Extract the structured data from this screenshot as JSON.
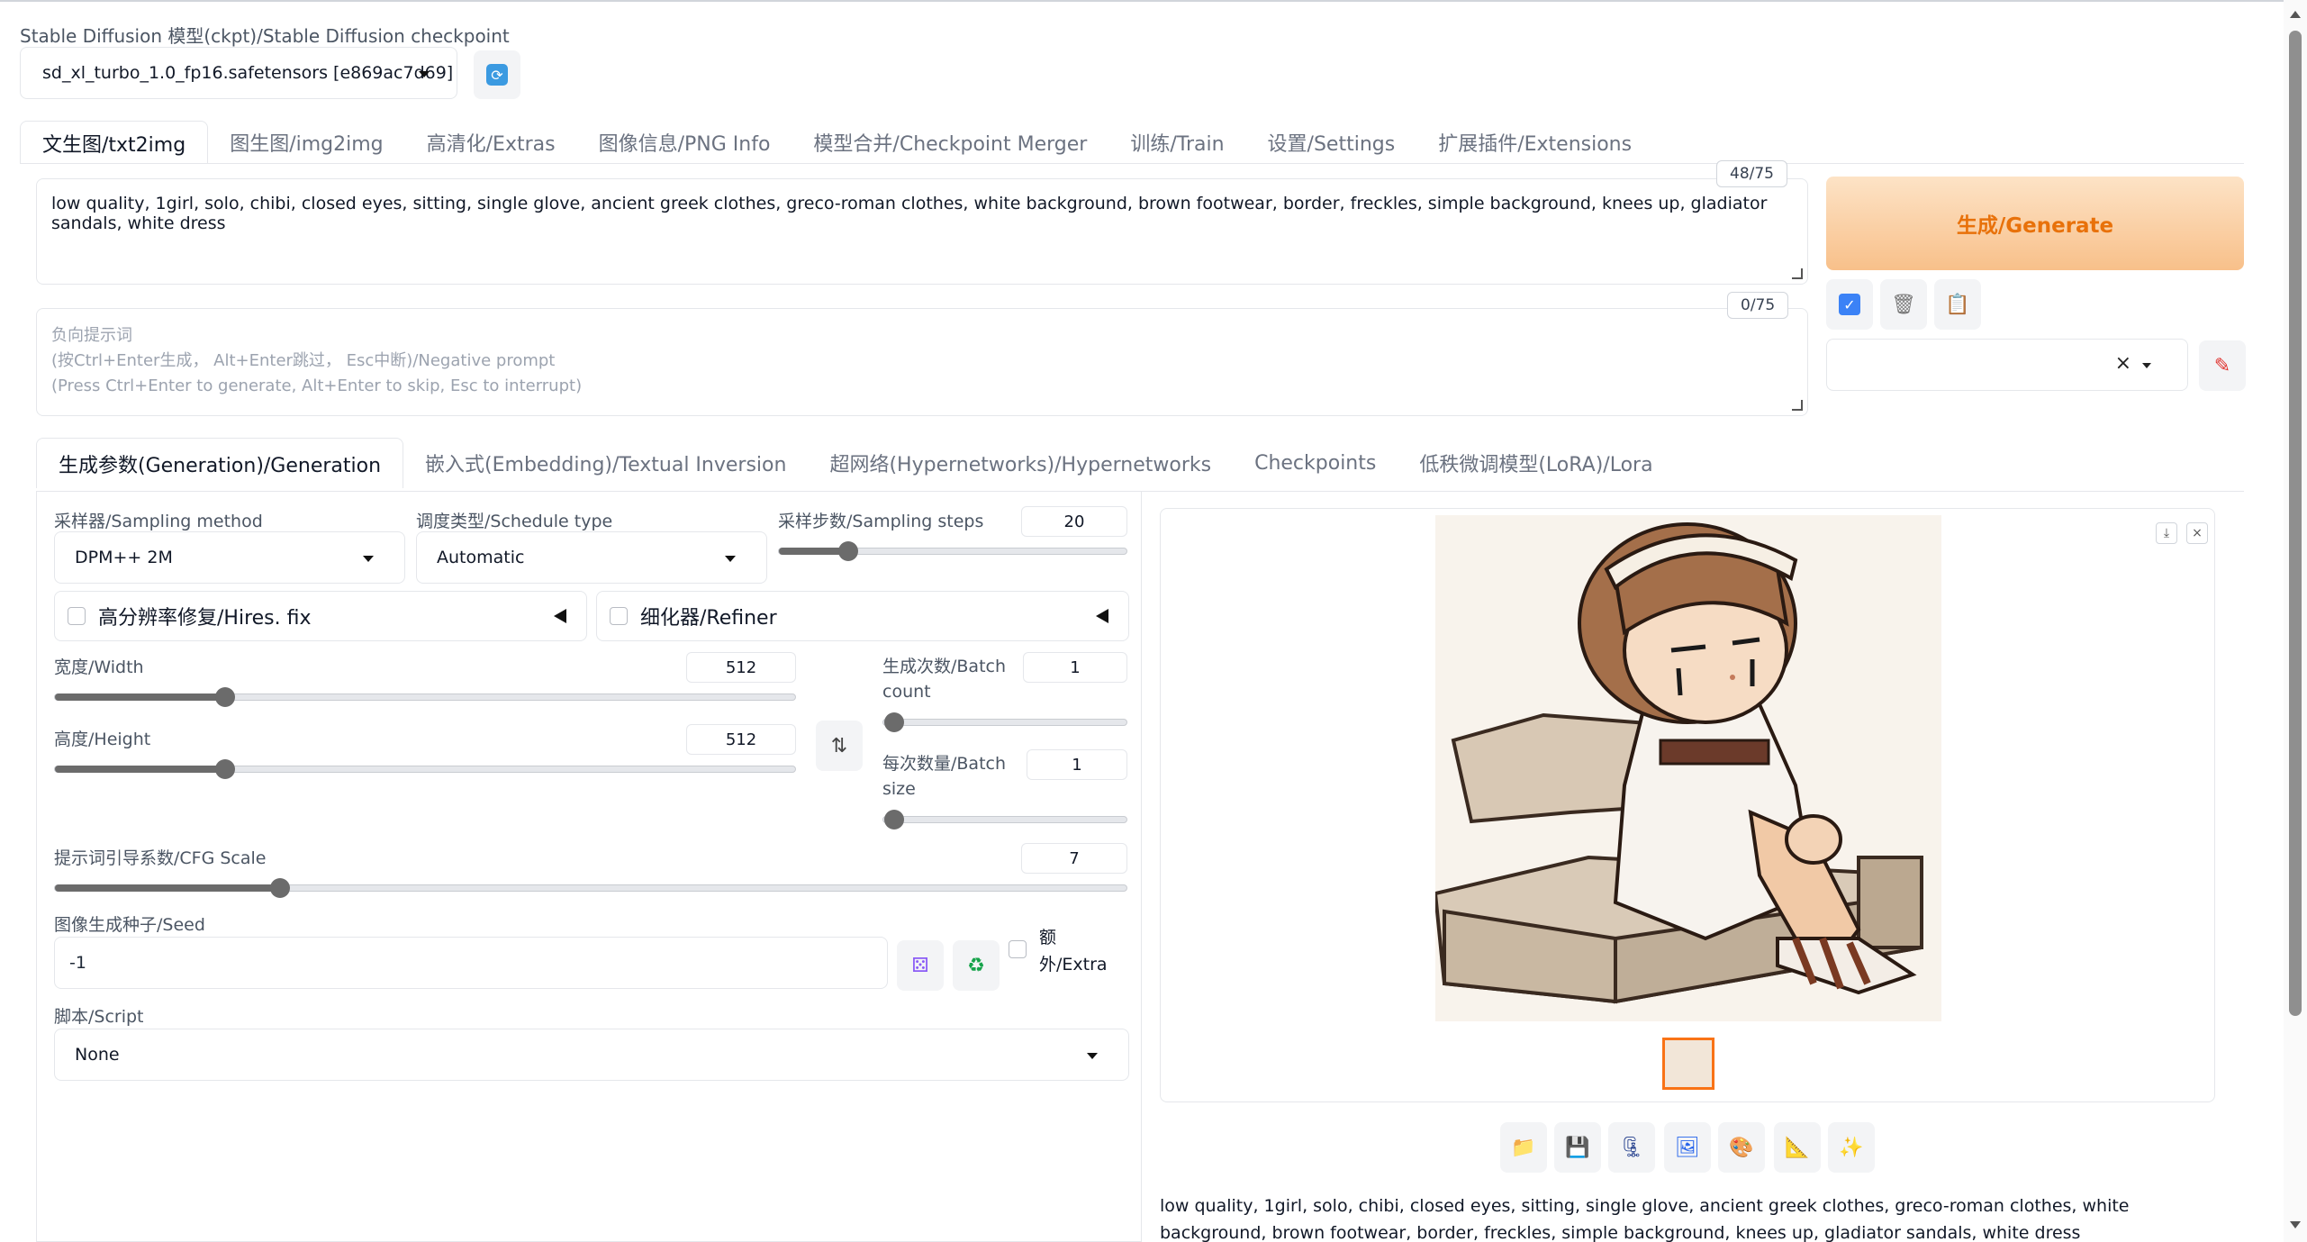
{
  "checkpoint": {
    "label": "Stable Diffusion 模型(ckpt)/Stable Diffusion checkpoint",
    "value": "sd_xl_turbo_1.0_fp16.safetensors [e869ac7d69]"
  },
  "main_tabs": [
    {
      "label": "文生图/txt2img",
      "active": true
    },
    {
      "label": "图生图/img2img"
    },
    {
      "label": "高清化/Extras"
    },
    {
      "label": "图像信息/PNG Info"
    },
    {
      "label": "模型合并/Checkpoint Merger"
    },
    {
      "label": "训练/Train"
    },
    {
      "label": "设置/Settings"
    },
    {
      "label": "扩展插件/Extensions"
    }
  ],
  "prompt": {
    "text": "low quality, 1girl, solo, chibi, closed eyes, sitting, single glove, ancient greek clothes, greco-roman clothes, white background, brown footwear, border, freckles, simple background, knees up, gladiator sandals, white dress",
    "counter": "48/75"
  },
  "negative_prompt": {
    "placeholder_lines": [
      "负向提示词",
      "(按Ctrl+Enter生成， Alt+Enter跳过， Esc中断)/Negative prompt",
      "(Press Ctrl+Enter to generate, Alt+Enter to skip, Esc to interrupt)"
    ],
    "counter": "0/75"
  },
  "generate_label": "生成/Generate",
  "sub_tabs": [
    {
      "label": "生成参数(Generation)/Generation",
      "active": true
    },
    {
      "label": "嵌入式(Embedding)/Textual Inversion"
    },
    {
      "label": "超网络(Hypernetworks)/Hypernetworks"
    },
    {
      "label": "Checkpoints"
    },
    {
      "label": "低秩微调模型(LoRA)/Lora"
    }
  ],
  "params": {
    "sampler_label": "采样器/Sampling method",
    "sampler_value": "DPM++ 2M",
    "schedule_label": "调度类型/Schedule type",
    "schedule_value": "Automatic",
    "steps_label": "采样步数/Sampling steps",
    "steps_value": "20",
    "steps_fraction": 0.2,
    "hires_label": "高分辨率修复/Hires. fix",
    "refiner_label": "细化器/Refiner",
    "width_label": "宽度/Width",
    "width_value": "512",
    "width_fraction": 0.23,
    "height_label": "高度/Height",
    "height_value": "512",
    "height_fraction": 0.23,
    "batch_count_label_1": "生成次数/Batch",
    "batch_count_label_2": "count",
    "batch_count_value": "1",
    "batch_size_label_1": "每次数量/Batch",
    "batch_size_label_2": "size",
    "batch_size_value": "1",
    "cfg_label": "提示词引导系数/CFG Scale",
    "cfg_value": "7",
    "cfg_fraction": 0.21,
    "seed_label": "图像生成种子/Seed",
    "seed_value": "-1",
    "extra_label_1": "额",
    "extra_label_2": "外/Extra",
    "script_label": "脚本/Script",
    "script_value": "None"
  },
  "output": {
    "info_text": "low quality, 1girl, solo, chibi, closed eyes, sitting, single glove, ancient greek clothes, greco-roman clothes, white background, brown footwear, border, freckles, simple background, knees up, gladiator sandals, white dress"
  },
  "icons": {
    "refresh": "refresh-icon",
    "style_apply": "check-icon",
    "trash": "trash-icon",
    "clipboard": "clipboard-icon",
    "edit": "brush-icon",
    "dice": "dice-icon",
    "recycle": "recycle-icon",
    "swap": "swap-icon",
    "download": "download-icon",
    "close": "close-icon",
    "folder": "folder-icon",
    "save": "save-icon",
    "zip": "zip-icon",
    "to_img2img": "image-icon",
    "to_inpaint": "palette-icon",
    "to_extras": "ruler-icon",
    "sparkle": "sparkle-icon"
  },
  "colors": {
    "accent": "#f97316",
    "generate_text": "#e8710a"
  }
}
